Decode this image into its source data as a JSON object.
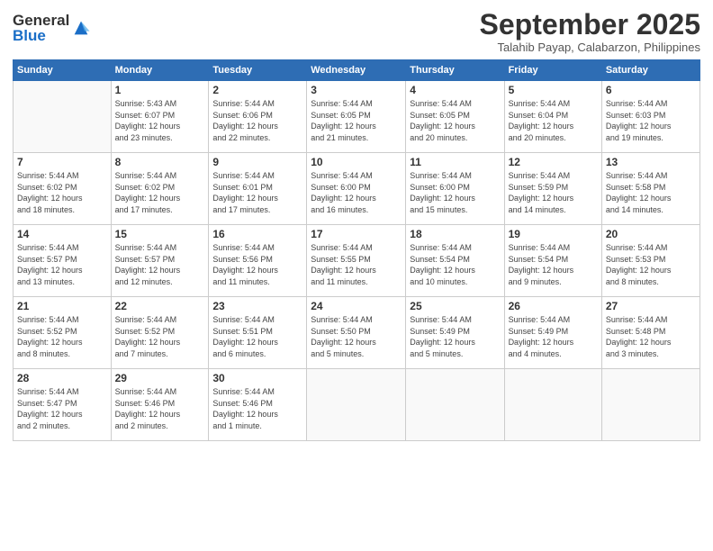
{
  "header": {
    "logo_general": "General",
    "logo_blue": "Blue",
    "month_title": "September 2025",
    "subtitle": "Talahib Payap, Calabarzon, Philippines"
  },
  "days_of_week": [
    "Sunday",
    "Monday",
    "Tuesday",
    "Wednesday",
    "Thursday",
    "Friday",
    "Saturday"
  ],
  "weeks": [
    [
      {
        "day": "",
        "info": ""
      },
      {
        "day": "1",
        "info": "Sunrise: 5:43 AM\nSunset: 6:07 PM\nDaylight: 12 hours\nand 23 minutes."
      },
      {
        "day": "2",
        "info": "Sunrise: 5:44 AM\nSunset: 6:06 PM\nDaylight: 12 hours\nand 22 minutes."
      },
      {
        "day": "3",
        "info": "Sunrise: 5:44 AM\nSunset: 6:05 PM\nDaylight: 12 hours\nand 21 minutes."
      },
      {
        "day": "4",
        "info": "Sunrise: 5:44 AM\nSunset: 6:05 PM\nDaylight: 12 hours\nand 20 minutes."
      },
      {
        "day": "5",
        "info": "Sunrise: 5:44 AM\nSunset: 6:04 PM\nDaylight: 12 hours\nand 20 minutes."
      },
      {
        "day": "6",
        "info": "Sunrise: 5:44 AM\nSunset: 6:03 PM\nDaylight: 12 hours\nand 19 minutes."
      }
    ],
    [
      {
        "day": "7",
        "info": "Sunrise: 5:44 AM\nSunset: 6:02 PM\nDaylight: 12 hours\nand 18 minutes."
      },
      {
        "day": "8",
        "info": "Sunrise: 5:44 AM\nSunset: 6:02 PM\nDaylight: 12 hours\nand 17 minutes."
      },
      {
        "day": "9",
        "info": "Sunrise: 5:44 AM\nSunset: 6:01 PM\nDaylight: 12 hours\nand 17 minutes."
      },
      {
        "day": "10",
        "info": "Sunrise: 5:44 AM\nSunset: 6:00 PM\nDaylight: 12 hours\nand 16 minutes."
      },
      {
        "day": "11",
        "info": "Sunrise: 5:44 AM\nSunset: 6:00 PM\nDaylight: 12 hours\nand 15 minutes."
      },
      {
        "day": "12",
        "info": "Sunrise: 5:44 AM\nSunset: 5:59 PM\nDaylight: 12 hours\nand 14 minutes."
      },
      {
        "day": "13",
        "info": "Sunrise: 5:44 AM\nSunset: 5:58 PM\nDaylight: 12 hours\nand 14 minutes."
      }
    ],
    [
      {
        "day": "14",
        "info": "Sunrise: 5:44 AM\nSunset: 5:57 PM\nDaylight: 12 hours\nand 13 minutes."
      },
      {
        "day": "15",
        "info": "Sunrise: 5:44 AM\nSunset: 5:57 PM\nDaylight: 12 hours\nand 12 minutes."
      },
      {
        "day": "16",
        "info": "Sunrise: 5:44 AM\nSunset: 5:56 PM\nDaylight: 12 hours\nand 11 minutes."
      },
      {
        "day": "17",
        "info": "Sunrise: 5:44 AM\nSunset: 5:55 PM\nDaylight: 12 hours\nand 11 minutes."
      },
      {
        "day": "18",
        "info": "Sunrise: 5:44 AM\nSunset: 5:54 PM\nDaylight: 12 hours\nand 10 minutes."
      },
      {
        "day": "19",
        "info": "Sunrise: 5:44 AM\nSunset: 5:54 PM\nDaylight: 12 hours\nand 9 minutes."
      },
      {
        "day": "20",
        "info": "Sunrise: 5:44 AM\nSunset: 5:53 PM\nDaylight: 12 hours\nand 8 minutes."
      }
    ],
    [
      {
        "day": "21",
        "info": "Sunrise: 5:44 AM\nSunset: 5:52 PM\nDaylight: 12 hours\nand 8 minutes."
      },
      {
        "day": "22",
        "info": "Sunrise: 5:44 AM\nSunset: 5:52 PM\nDaylight: 12 hours\nand 7 minutes."
      },
      {
        "day": "23",
        "info": "Sunrise: 5:44 AM\nSunset: 5:51 PM\nDaylight: 12 hours\nand 6 minutes."
      },
      {
        "day": "24",
        "info": "Sunrise: 5:44 AM\nSunset: 5:50 PM\nDaylight: 12 hours\nand 5 minutes."
      },
      {
        "day": "25",
        "info": "Sunrise: 5:44 AM\nSunset: 5:49 PM\nDaylight: 12 hours\nand 5 minutes."
      },
      {
        "day": "26",
        "info": "Sunrise: 5:44 AM\nSunset: 5:49 PM\nDaylight: 12 hours\nand 4 minutes."
      },
      {
        "day": "27",
        "info": "Sunrise: 5:44 AM\nSunset: 5:48 PM\nDaylight: 12 hours\nand 3 minutes."
      }
    ],
    [
      {
        "day": "28",
        "info": "Sunrise: 5:44 AM\nSunset: 5:47 PM\nDaylight: 12 hours\nand 2 minutes."
      },
      {
        "day": "29",
        "info": "Sunrise: 5:44 AM\nSunset: 5:46 PM\nDaylight: 12 hours\nand 2 minutes."
      },
      {
        "day": "30",
        "info": "Sunrise: 5:44 AM\nSunset: 5:46 PM\nDaylight: 12 hours\nand 1 minute."
      },
      {
        "day": "",
        "info": ""
      },
      {
        "day": "",
        "info": ""
      },
      {
        "day": "",
        "info": ""
      },
      {
        "day": "",
        "info": ""
      }
    ]
  ]
}
